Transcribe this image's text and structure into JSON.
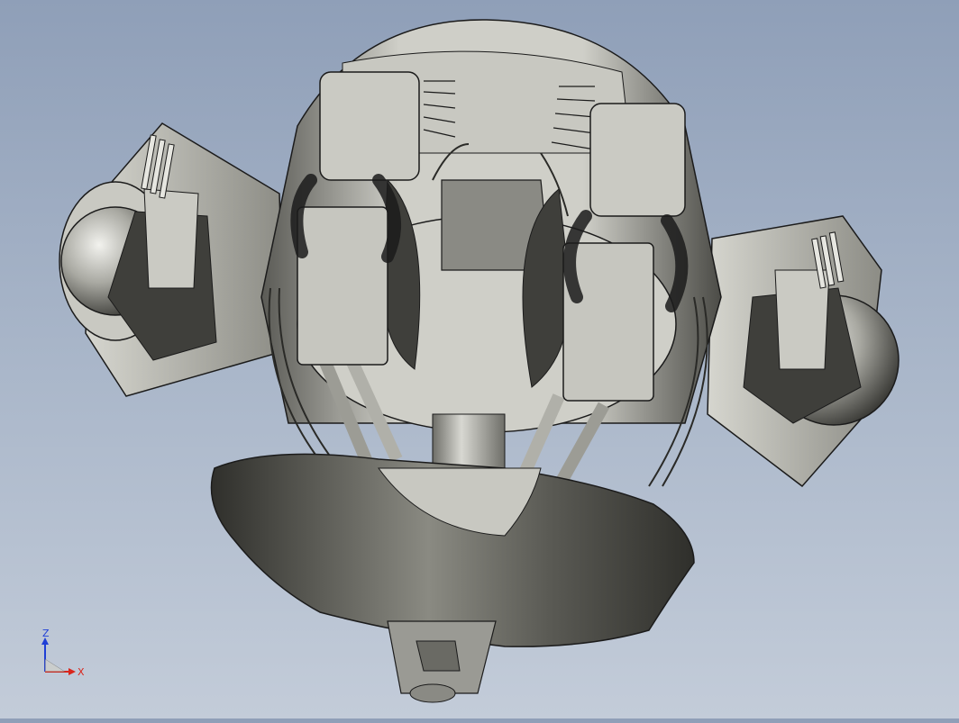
{
  "view": {
    "background_top": "#8f9fb8",
    "background_bottom": "#c3ccd9"
  },
  "triad": {
    "x_label": "X",
    "y_label": "",
    "z_label": "Z",
    "x_color": "#d9261c",
    "z_color": "#1f3fd6",
    "y_color": "#20a030"
  },
  "model": {
    "body_color": "#b9b9b2",
    "shadow_color": "#4a4a45",
    "edge_color": "#1b1b1b"
  }
}
